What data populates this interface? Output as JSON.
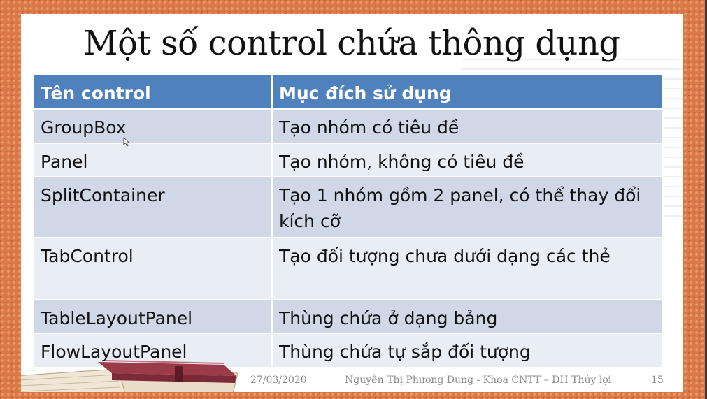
{
  "slide": {
    "title": "Một số control chứa thông dụng",
    "table": {
      "headers": [
        "Tên control",
        "Mục đích sử dụng"
      ],
      "rows": [
        {
          "name": "GroupBox",
          "purpose": "Tạo nhóm có tiêu đề"
        },
        {
          "name": "Panel",
          "purpose": "Tạo nhóm, không có tiêu đề"
        },
        {
          "name": "SplitContainer",
          "purpose": "Tạo 1 nhóm gồm 2 panel, có thể thay đổi kích cỡ"
        },
        {
          "name": "TabControl",
          "purpose": "Tạo đối tượng chưa dưới dạng các thẻ"
        },
        {
          "name": "TableLayoutPanel",
          "purpose": "Thùng chứa ở dạng bảng"
        },
        {
          "name": "FlowLayoutPanel",
          "purpose": "Thùng chứa tự sắp đối tượng"
        }
      ]
    },
    "footer": {
      "date": "27/03/2020",
      "author": "Nguyễn Thị Phương Dung - Khoa CNTT – ĐH Thủy lợi",
      "page": "15"
    }
  },
  "colors": {
    "header_bg": "#4f81bd",
    "row_odd_bg": "#d0d8e8",
    "row_even_bg": "#e9edf4",
    "frame": "#d9794a"
  },
  "icons": [
    "book-illustration",
    "mouse-cursor-icon"
  ]
}
